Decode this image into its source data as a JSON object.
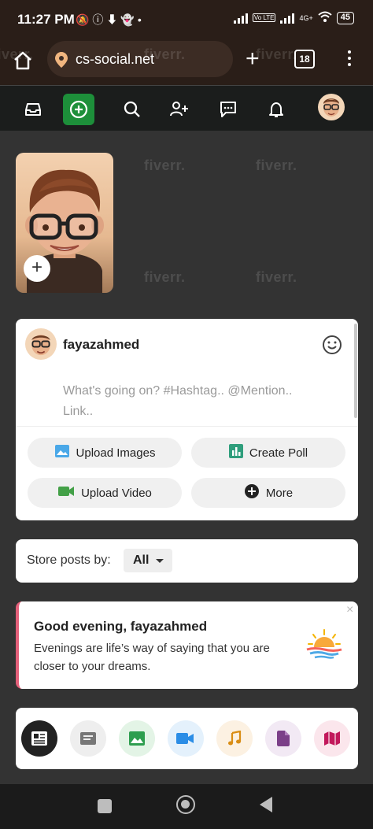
{
  "status": {
    "time": "11:27 PM",
    "network_tags": [
      "Vo LTE",
      "4G+"
    ],
    "battery": "45"
  },
  "browser": {
    "url": "cs-social.net",
    "tab_count": "18"
  },
  "nav": {
    "icons": [
      "home-icon",
      "add-circle-icon",
      "search-icon",
      "add-user-icon",
      "messages-icon",
      "notifications-icon",
      "profile-avatar"
    ]
  },
  "watermark": "fiverr.",
  "composer": {
    "username": "fayazahmed",
    "placeholder": "What's going on? #Hashtag.. @Mention.. Link..",
    "upload_images": "Upload Images",
    "create_poll": "Create Poll",
    "upload_video": "Upload Video",
    "more": "More"
  },
  "filter": {
    "label": "Store posts by:",
    "selected": "All"
  },
  "greeting": {
    "title": "Good evening, fayazahmed",
    "text": "Evenings are life’s way of saying that you are closer to your dreams.",
    "close": "×"
  },
  "post_types": [
    {
      "name": "all-posts-icon",
      "bg": "#222222",
      "fg": "#ffffff"
    },
    {
      "name": "text-posts-icon",
      "bg": "#eeeeee",
      "fg": "#777777"
    },
    {
      "name": "image-posts-icon",
      "bg": "#e3f4e6",
      "fg": "#2e9e4f"
    },
    {
      "name": "video-posts-icon",
      "bg": "#e4f1fc",
      "fg": "#2b8de6"
    },
    {
      "name": "music-posts-icon",
      "bg": "#fcf1e2",
      "fg": "#d98d14"
    },
    {
      "name": "file-posts-icon",
      "bg": "#f2e9f4",
      "fg": "#7b3f88"
    },
    {
      "name": "map-posts-icon",
      "bg": "#fbe6ec",
      "fg": "#c2185b"
    }
  ],
  "colors": {
    "accent_green": "#1d8f3a",
    "greeting_border": "#e4607a"
  }
}
